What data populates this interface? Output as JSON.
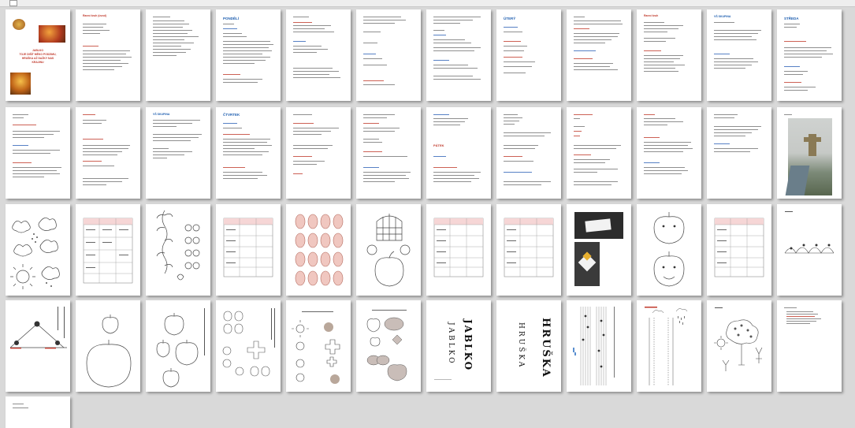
{
  "cover": {
    "title_lines": [
      "JABLKO",
      "TOJE DIŠÍT MĚKO PODZIMU,",
      "HRUŠKA AŽ DAŽKY NAS",
      "KRAJINU"
    ]
  },
  "page_headings": {
    "p2": "Ranní kruh (úvod)",
    "p4": "PONDĚLÍ",
    "p10": "ÚTERÝ",
    "p13": "Ranní kruh",
    "p14": "VŠ SKUPINA",
    "p15": "STŘEDA",
    "p18": "VŠ SKUPINA",
    "p19": "ČTVRTEK",
    "p23": "PÁTEK"
  },
  "word_pages": {
    "jablko": "JABLKO",
    "hruska": "HRUŠKA"
  }
}
